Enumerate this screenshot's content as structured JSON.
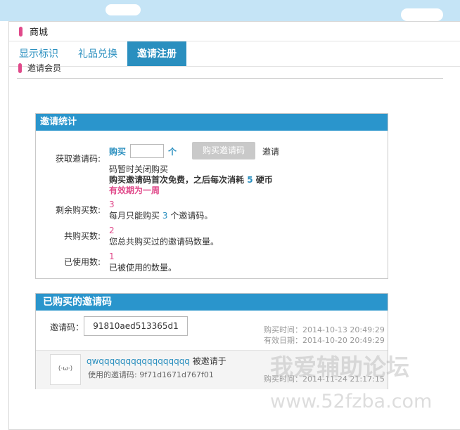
{
  "panel": {
    "title": "商城"
  },
  "tabs": [
    {
      "label": "显示标识"
    },
    {
      "label": "礼品兑换"
    },
    {
      "label": "邀请注册"
    }
  ],
  "section": {
    "title": "邀请会员"
  },
  "stats": {
    "title": "邀请统计",
    "get_code": {
      "label": "获取邀请码:",
      "buy_prefix": "购买",
      "unit": "个",
      "button": "购买邀请码",
      "after_button": "邀请",
      "closed_text": "码暂时关闭购买",
      "price_text": "购买邀请码首次免费，之后每次消耗",
      "price_value": "5",
      "price_unit": "硬币",
      "validity": "有效期为一周"
    },
    "remaining": {
      "label": "剩余购买数:",
      "value": "3",
      "note_prefix": "每月只能购买",
      "note_value": "3",
      "note_suffix": "个邀请码。"
    },
    "total": {
      "label": "共购买数:",
      "value": "2",
      "note": "您总共购买过的邀请码数量。"
    },
    "used": {
      "label": "已使用数:",
      "value": "1",
      "note": "已被使用的数量。"
    }
  },
  "purchased": {
    "title": "已购买的邀请码",
    "code_label": "邀请码：",
    "code_value": "91810aed513365d1",
    "buy_time": "购买时间：2014-10-13 20:49:29",
    "expire_time": "有效日期：2014-10-20 20:49:29",
    "record": {
      "avatar_text": "(·ω·)",
      "username": "qwqqqqqqqqqqqqqqqqq",
      "invited_text": "被邀请于",
      "used_code": "使用的邀请码: 9f71d1671d767f01",
      "buy_time": "购买时间：2014-11-24 21:17:15"
    }
  },
  "watermark": {
    "line1": "我爱辅助论坛",
    "line2": "www.52fzba.com"
  },
  "colors": {
    "accent": "#2a95cc",
    "pink": "#e0498a"
  }
}
